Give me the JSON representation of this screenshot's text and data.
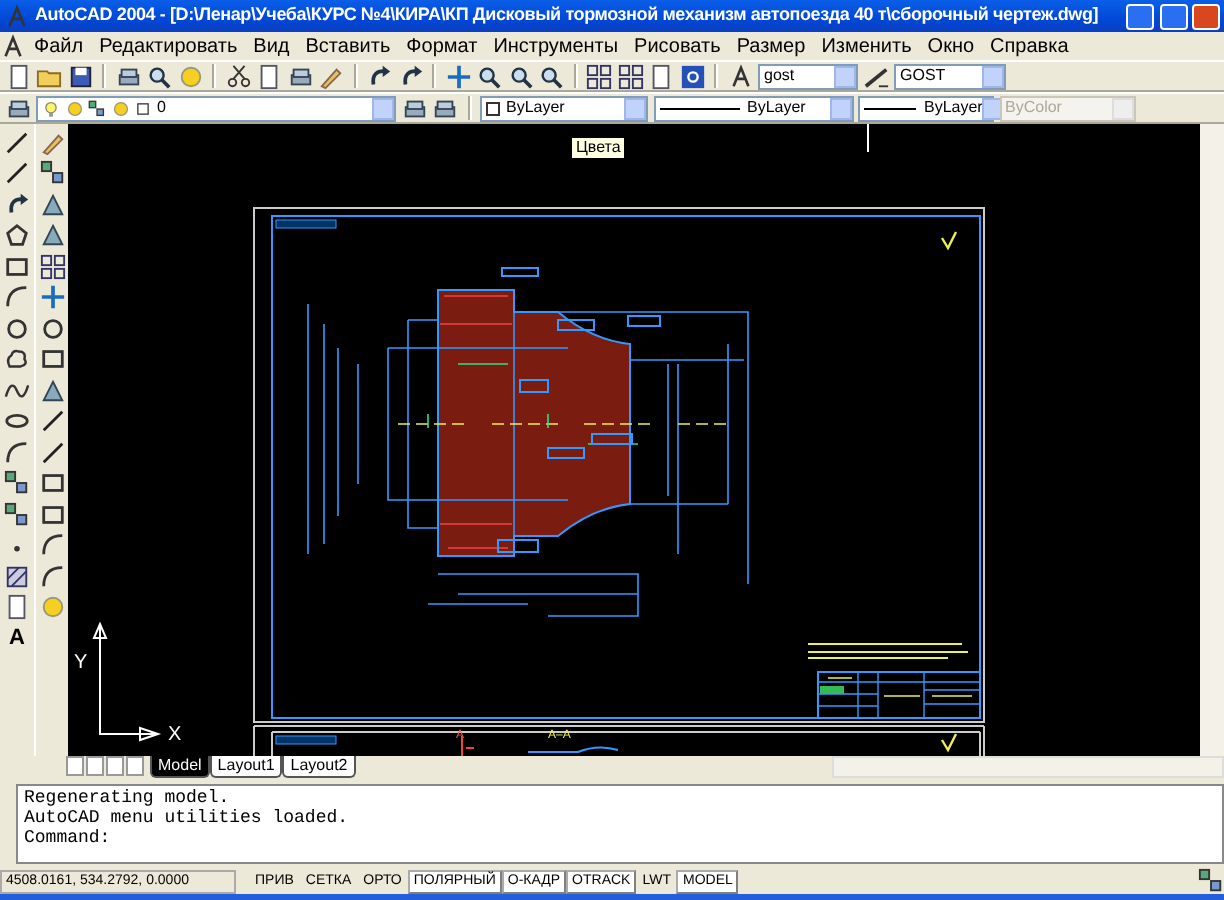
{
  "window": {
    "title": "AutoCAD 2004 - [D:\\Ленар\\Учеба\\КУРС №4\\КИРА\\КП Дисковый тормозной механизм автопоезда 40 т\\сборочный чертеж.dwg]"
  },
  "menu": [
    "Файл",
    "Редактировать",
    "Вид",
    "Вставить",
    "Формат",
    "Инструменты",
    "Рисовать",
    "Размер",
    "Изменить",
    "Окно",
    "Справка"
  ],
  "styles": {
    "text_style": "gost",
    "dim_style": "GOST"
  },
  "layer": {
    "value": "0"
  },
  "properties": [
    {
      "kind": "color",
      "value": "ByLayer",
      "disabled": false
    },
    {
      "kind": "linetype",
      "value": "ByLayer",
      "disabled": false
    },
    {
      "kind": "lineweight",
      "value": "ByLayer",
      "disabled": false
    },
    {
      "kind": "plotstyle",
      "value": "ByColor",
      "disabled": true
    }
  ],
  "tooltip": "Цвета",
  "draw_toolbar": {
    "text_tool": "A"
  },
  "canvas": {
    "ucs_labels": [
      "Y",
      "X"
    ],
    "section_labels": [
      "A",
      "A–A"
    ]
  },
  "layout_tabs": [
    {
      "label": "Model",
      "selected": true
    },
    {
      "label": "Layout1",
      "selected": false
    },
    {
      "label": "Layout2",
      "selected": false
    }
  ],
  "command_history": [
    "Regenerating model.",
    "AutoCAD menu utilities loaded."
  ],
  "command_prompt": "Command:",
  "status_bar": {
    "coordinates": "4508.0161, 534.2792, 0.0000",
    "toggles": [
      {
        "label": "ПРИВ",
        "on": false
      },
      {
        "label": "СЕТКА",
        "on": false
      },
      {
        "label": "ОРТО",
        "on": false
      },
      {
        "label": "ПОЛЯРНЫЙ",
        "on": true
      },
      {
        "label": "О-КАДР",
        "on": true
      },
      {
        "label": "OTRACK",
        "on": true
      },
      {
        "label": "LWT",
        "on": false
      },
      {
        "label": "MODEL",
        "on": true
      }
    ]
  }
}
